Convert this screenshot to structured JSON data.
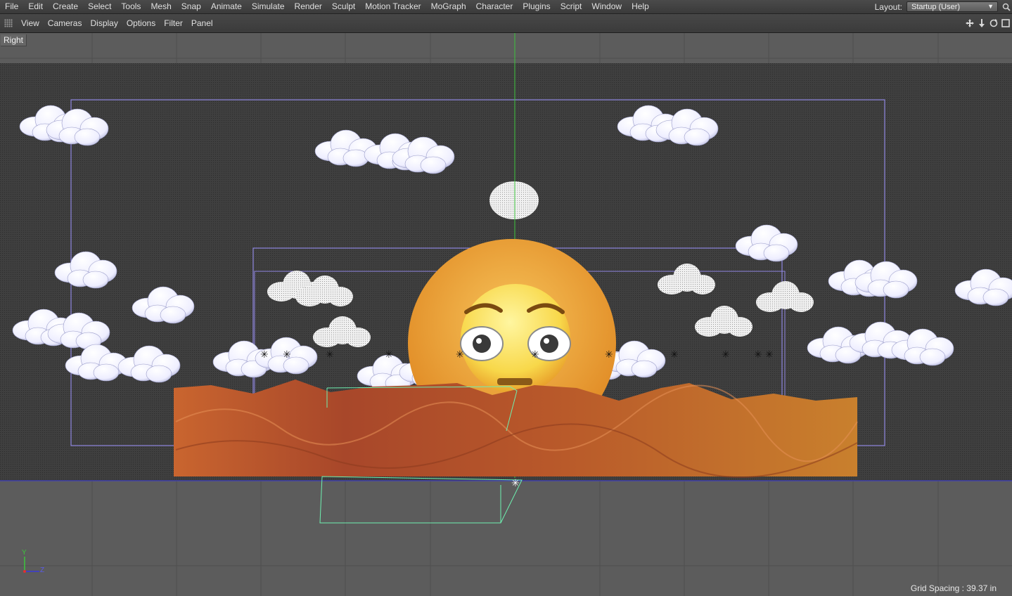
{
  "menubar": {
    "items": [
      "File",
      "Edit",
      "Create",
      "Select",
      "Tools",
      "Mesh",
      "Snap",
      "Animate",
      "Simulate",
      "Render",
      "Sculpt",
      "Motion Tracker",
      "MoGraph",
      "Character",
      "Plugins",
      "Script",
      "Window",
      "Help"
    ],
    "layout_label": "Layout:",
    "layout_value": "Startup (User)"
  },
  "viewmenu": {
    "items": [
      "View",
      "Cameras",
      "Display",
      "Options",
      "Filter",
      "Panel"
    ]
  },
  "viewport": {
    "view_name": "Right",
    "grid_spacing": "Grid Spacing : 39.37 in",
    "axis_y": "Y",
    "axis_z": "Z"
  },
  "colors": {
    "background_render": "#3d3d3d",
    "sun": "#f0a030",
    "terrain": "#b85a28",
    "frame_outline": "#8f86e0",
    "camera_outline": "#6ef0b0",
    "axis_green": "#3cc43c",
    "axis_blue": "#3a3ad8"
  }
}
